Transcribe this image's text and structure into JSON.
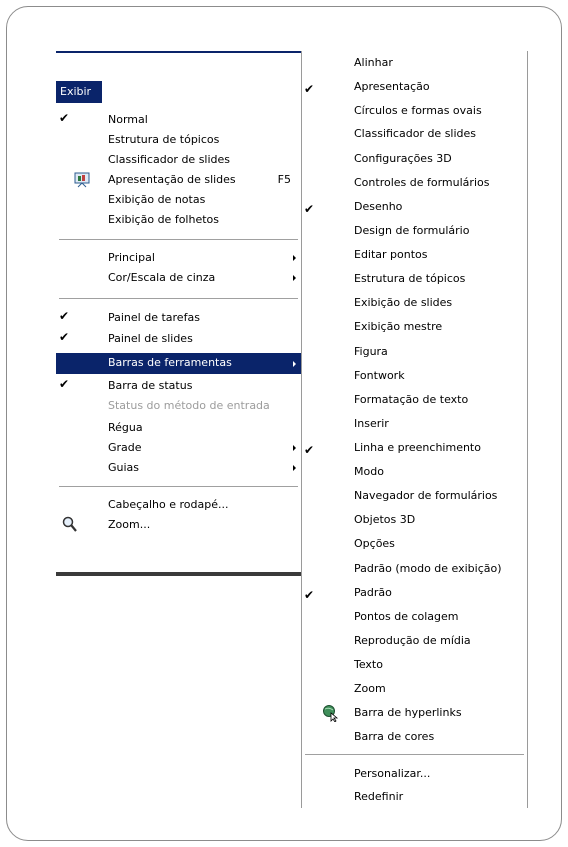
{
  "menu_bar": {
    "active_menu": "Exibir"
  },
  "exibir_menu": {
    "items": [
      {
        "label": "Normal",
        "checked": true
      },
      {
        "label": "Estrutura de tópicos"
      },
      {
        "label": "Classificador de slides"
      },
      {
        "label": "Apresentação de slides",
        "shortcut": "F5",
        "icon": "presentation-icon"
      },
      {
        "label": "Exibição de notas"
      },
      {
        "label": "Exibição de folhetos"
      },
      {
        "label": "Principal",
        "submenu": true
      },
      {
        "label": "Cor/Escala de cinza",
        "submenu": true
      },
      {
        "label": "Painel de tarefas",
        "checked": true
      },
      {
        "label": "Painel de slides",
        "checked": true
      },
      {
        "label": "Barras de ferramentas",
        "submenu": true,
        "highlighted": true
      },
      {
        "label": "Barra de status",
        "checked": true
      },
      {
        "label": "Status do método de entrada",
        "disabled": true
      },
      {
        "label": "Régua"
      },
      {
        "label": "Grade",
        "submenu": true
      },
      {
        "label": "Guias",
        "submenu": true
      },
      {
        "label": "Cabeçalho e rodapé..."
      },
      {
        "label": "Zoom...",
        "icon": "zoom-magnifier-icon"
      }
    ]
  },
  "toolbars_submenu": {
    "items": [
      {
        "label": "Alinhar"
      },
      {
        "label": "Apresentação",
        "checked": true
      },
      {
        "label": "Círculos e formas ovais"
      },
      {
        "label": "Classificador de slides"
      },
      {
        "label": "Configurações 3D"
      },
      {
        "label": "Controles de formulários"
      },
      {
        "label": "Desenho",
        "checked": true
      },
      {
        "label": "Design de formulário"
      },
      {
        "label": "Editar pontos"
      },
      {
        "label": "Estrutura de tópicos"
      },
      {
        "label": "Exibição de slides"
      },
      {
        "label": "Exibição mestre"
      },
      {
        "label": "Figura"
      },
      {
        "label": "Fontwork"
      },
      {
        "label": "Formatação de texto"
      },
      {
        "label": "Inserir"
      },
      {
        "label": "Linha e preenchimento",
        "checked": true
      },
      {
        "label": "Modo"
      },
      {
        "label": "Navegador de formulários"
      },
      {
        "label": "Objetos 3D"
      },
      {
        "label": "Opções"
      },
      {
        "label": "Padrão (modo de exibição)"
      },
      {
        "label": "Padrão",
        "checked": true
      },
      {
        "label": "Pontos de colagem"
      },
      {
        "label": "Reprodução de mídia"
      },
      {
        "label": "Texto"
      },
      {
        "label": "Zoom"
      },
      {
        "label": "Barra de hyperlinks",
        "icon": "hyperlink-globe-icon"
      },
      {
        "label": "Barra de cores"
      },
      {
        "label": "Personalizar..."
      },
      {
        "label": "Redefinir"
      }
    ]
  },
  "colors": {
    "highlight": "#0a246a",
    "frame": "#8c8c8c",
    "disabled": "#9c9c9c"
  }
}
